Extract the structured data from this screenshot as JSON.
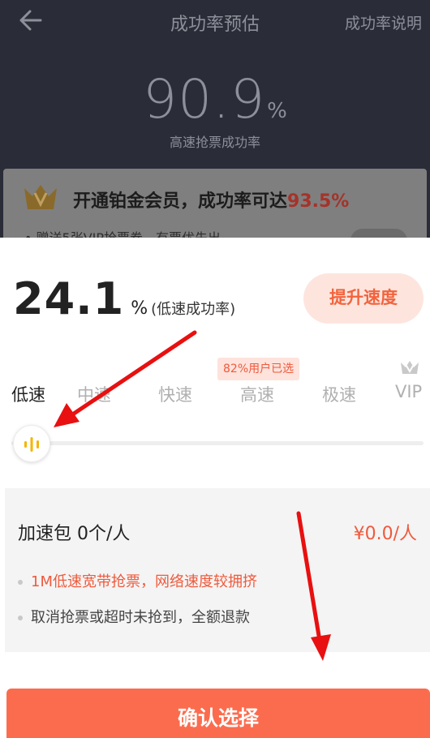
{
  "background": {
    "title": "成功率预估",
    "explain_link": "成功率说明",
    "big_rate_value": "90.9",
    "big_rate_unit": "%",
    "big_rate_label": "高速抢票成功率",
    "vip_card": {
      "title_prefix": "开通铂金会员，成功率可达",
      "title_highlight": "93.5%",
      "subtitle": "• 赠送5张VIP抢票券，有票优先出"
    }
  },
  "sheet": {
    "rate_value": "24.1",
    "rate_unit": "%",
    "rate_label": "(低速成功率)",
    "boost_button": "提升速度",
    "popular_badge": "82%用户已选",
    "speed_tabs": [
      {
        "label": "低速",
        "active": true
      },
      {
        "label": "中速",
        "active": false
      },
      {
        "label": "快速",
        "active": false
      },
      {
        "label": "高速",
        "active": false
      },
      {
        "label": "极速",
        "active": false
      },
      {
        "label": "VIP",
        "active": false
      }
    ],
    "package": {
      "label": "加速包 0个/人",
      "price": "¥0.0/人",
      "notes": [
        "1M低速宽带抢票，网络速度较拥挤",
        "取消抢票或超时未抢到，全额退款"
      ]
    },
    "confirm_button": "确认选择"
  },
  "colors": {
    "accent": "#fb6c4e",
    "accent_text": "#ef5a3d",
    "knob_icon": "#f5b400",
    "overlay": "#2a2c38",
    "annotation_arrow": "#e81010"
  },
  "icons": {
    "back": "back-arrow-icon",
    "crown": "crown-icon",
    "slider": "sound-bars-icon"
  }
}
